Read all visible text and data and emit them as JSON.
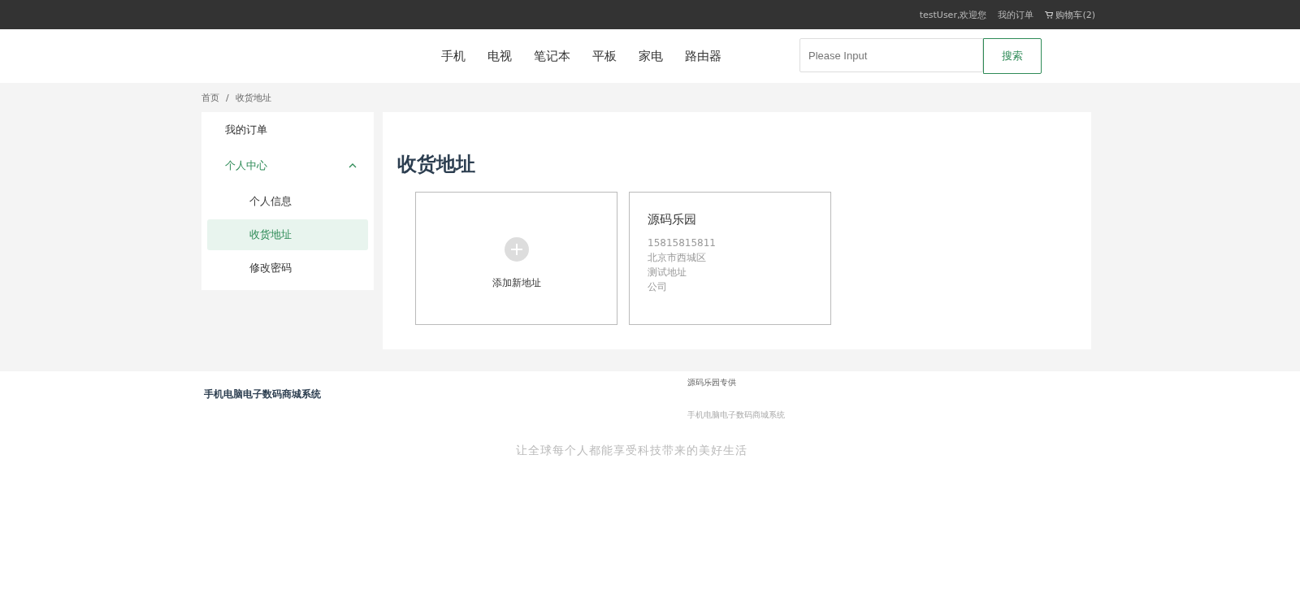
{
  "top_bar": {
    "greeting": "testUser,欢迎您",
    "orders_link": "我的订单",
    "cart_link": "购物车(2)"
  },
  "nav": {
    "items": [
      "手机",
      "电视",
      "笔记本",
      "平板",
      "家电",
      "路由器"
    ],
    "search": {
      "placeholder": "Please Input",
      "button": "搜索"
    }
  },
  "breadcrumb": {
    "separator": "/",
    "items": [
      "首页",
      "收货地址"
    ]
  },
  "sidebar": {
    "items": [
      {
        "label": "我的订单",
        "selected": false
      },
      {
        "label": "个人中心",
        "selected": false,
        "expanded": true,
        "children": [
          {
            "label": "个人信息",
            "selected": false
          },
          {
            "label": "收货地址",
            "selected": true
          },
          {
            "label": "修改密码",
            "selected": false
          }
        ]
      }
    ]
  },
  "main": {
    "title": "收货地址",
    "add_card": {
      "label": "添加新地址"
    },
    "addresses": [
      {
        "name": "源码乐园",
        "lines": [
          "15815815811",
          "北京市西城区",
          "测试地址",
          "公司"
        ]
      }
    ]
  },
  "footer": {
    "brand": "手机电脑电子数码商城系统",
    "credit": "源码乐园专供",
    "subtitle": "手机电脑电子数码商城系统",
    "slogan": "让全球每个人都能享受科技带来的美好生活"
  }
}
